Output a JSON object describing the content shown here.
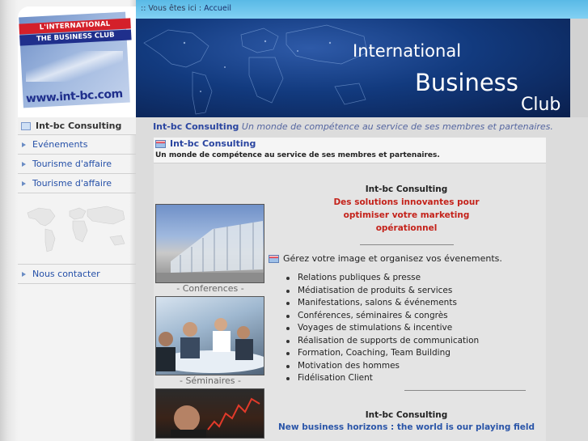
{
  "logo": {
    "line1": "L'INTERNATIONAL",
    "line2": "THE BUSINESS CLUB",
    "url": "www.int-bc.com"
  },
  "breadcrumb": {
    "prefix": ":: Vous êtes ici :",
    "current": "Accueil"
  },
  "banner": {
    "line1": "International",
    "line2": "Business",
    "line3": "Club"
  },
  "tagline": {
    "brand": "Int-bc Consulting",
    "text": "Un monde de compétence au service de ses membres et partenaires."
  },
  "sidebar": {
    "items": [
      {
        "label": "Int-bc Consulting",
        "active": true
      },
      {
        "label": "Evénements",
        "active": false
      },
      {
        "label": "Tourisme d'affaire",
        "active": false
      },
      {
        "label": "Tourisme d'affaire",
        "active": false
      }
    ],
    "contact": {
      "label": "Nous contacter"
    }
  },
  "main": {
    "header_title": "Int-bc Consulting",
    "header_subtitle": "Un monde de compétence au service de ses membres et partenaires.",
    "section1": {
      "title": "Int-bc Consulting",
      "subtitle": "Des solutions innovantes pour optimiser votre marketing opérationnel",
      "intro": "Gérez votre image et organisez vos évenements.",
      "services": [
        "Relations publiques & presse",
        "Médiatisation de produits & services",
        "Manifestations, salons & événements",
        "Conférences, séminaires & congrès",
        "Voyages de stimulations & incentive",
        "Réalisation de supports de communication",
        "Formation, Coaching, Team Building",
        "Motivation des hommes",
        "Fidélisation Client"
      ]
    },
    "section2": {
      "title": "Int-bc Consulting",
      "subtitle": "New business horizons : the world is our playing field"
    },
    "photos": {
      "caption1": "- Conferences -",
      "caption2": "- Séminaires -"
    }
  },
  "colors": {
    "accent_blue": "#2a45a0",
    "highlight_red": "#c4221a",
    "breadcrumb_bg": "#59b9e6"
  }
}
